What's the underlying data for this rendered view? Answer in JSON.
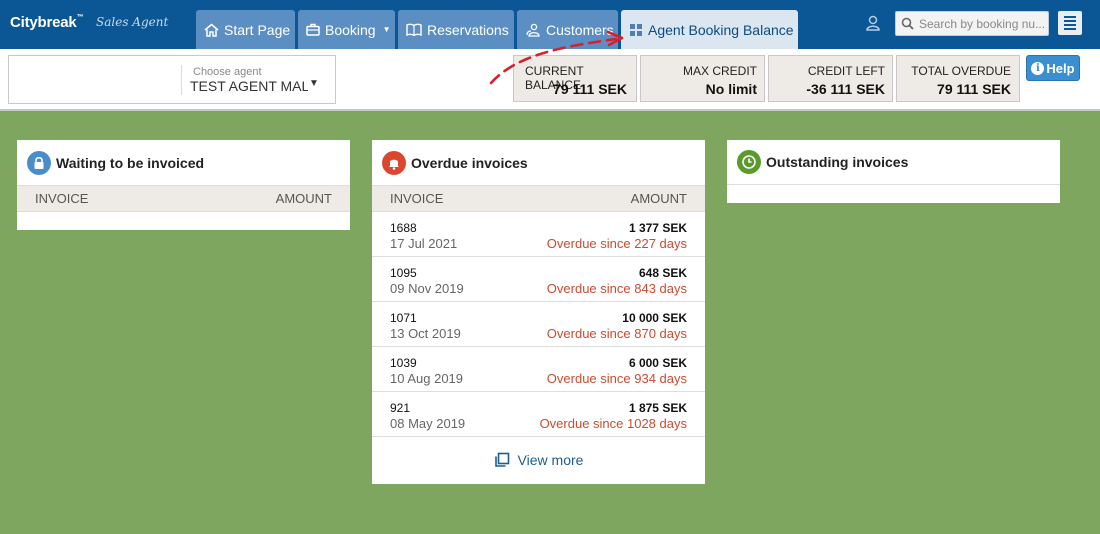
{
  "header": {
    "brand": "Citybreak",
    "brand_tm": "™",
    "brand_sub": "Sales Agent",
    "tabs": [
      {
        "label": "Start Page",
        "icon": "home-icon"
      },
      {
        "label": "Booking",
        "icon": "briefcase-icon",
        "dropdown": true
      },
      {
        "label": "Reservations",
        "icon": "book-icon"
      },
      {
        "label": "Customers",
        "icon": "customers-icon"
      },
      {
        "label": "Agent Booking Balance",
        "icon": "grid-icon",
        "active": true
      }
    ],
    "search_placeholder": "Search by booking nu..."
  },
  "agent": {
    "label": "Choose agent",
    "value": "TEST AGENT MALE"
  },
  "balance": [
    {
      "title": "CURRENT BALANCE",
      "value": "79 111 SEK"
    },
    {
      "title": "MAX CREDIT",
      "value": "No limit"
    },
    {
      "title": "CREDIT LEFT",
      "value": "-36 111 SEK"
    },
    {
      "title": "TOTAL OVERDUE",
      "value": "79 111 SEK"
    }
  ],
  "help_label": "Help",
  "cards": {
    "waiting": {
      "title": "Waiting to be invoiced",
      "col_invoice": "INVOICE",
      "col_amount": "AMOUNT"
    },
    "overdue": {
      "title": "Overdue invoices",
      "col_invoice": "INVOICE",
      "col_amount": "AMOUNT",
      "rows": [
        {
          "number": "1688",
          "date": "17 Jul 2021",
          "amount": "1 377 SEK",
          "overdue": "Overdue since 227 days"
        },
        {
          "number": "1095",
          "date": "09 Nov 2019",
          "amount": "648 SEK",
          "overdue": "Overdue since 843 days"
        },
        {
          "number": "1071",
          "date": "13 Oct 2019",
          "amount": "10 000 SEK",
          "overdue": "Overdue since 870 days"
        },
        {
          "number": "1039",
          "date": "10 Aug 2019",
          "amount": "6 000 SEK",
          "overdue": "Overdue since 934 days"
        },
        {
          "number": "921",
          "date": "08 May 2019",
          "amount": "1 875 SEK",
          "overdue": "Overdue since 1028 days"
        }
      ],
      "view_more": "View more"
    },
    "outstanding": {
      "title": "Outstanding invoices"
    }
  },
  "colors": {
    "nav": "#0b5796",
    "tab": "#5b8fc4",
    "tab_active": "#dbe6f1",
    "background": "#7fa65f",
    "overdue_text": "#cc4b2f",
    "annotation_arrow": "#d9202a"
  }
}
